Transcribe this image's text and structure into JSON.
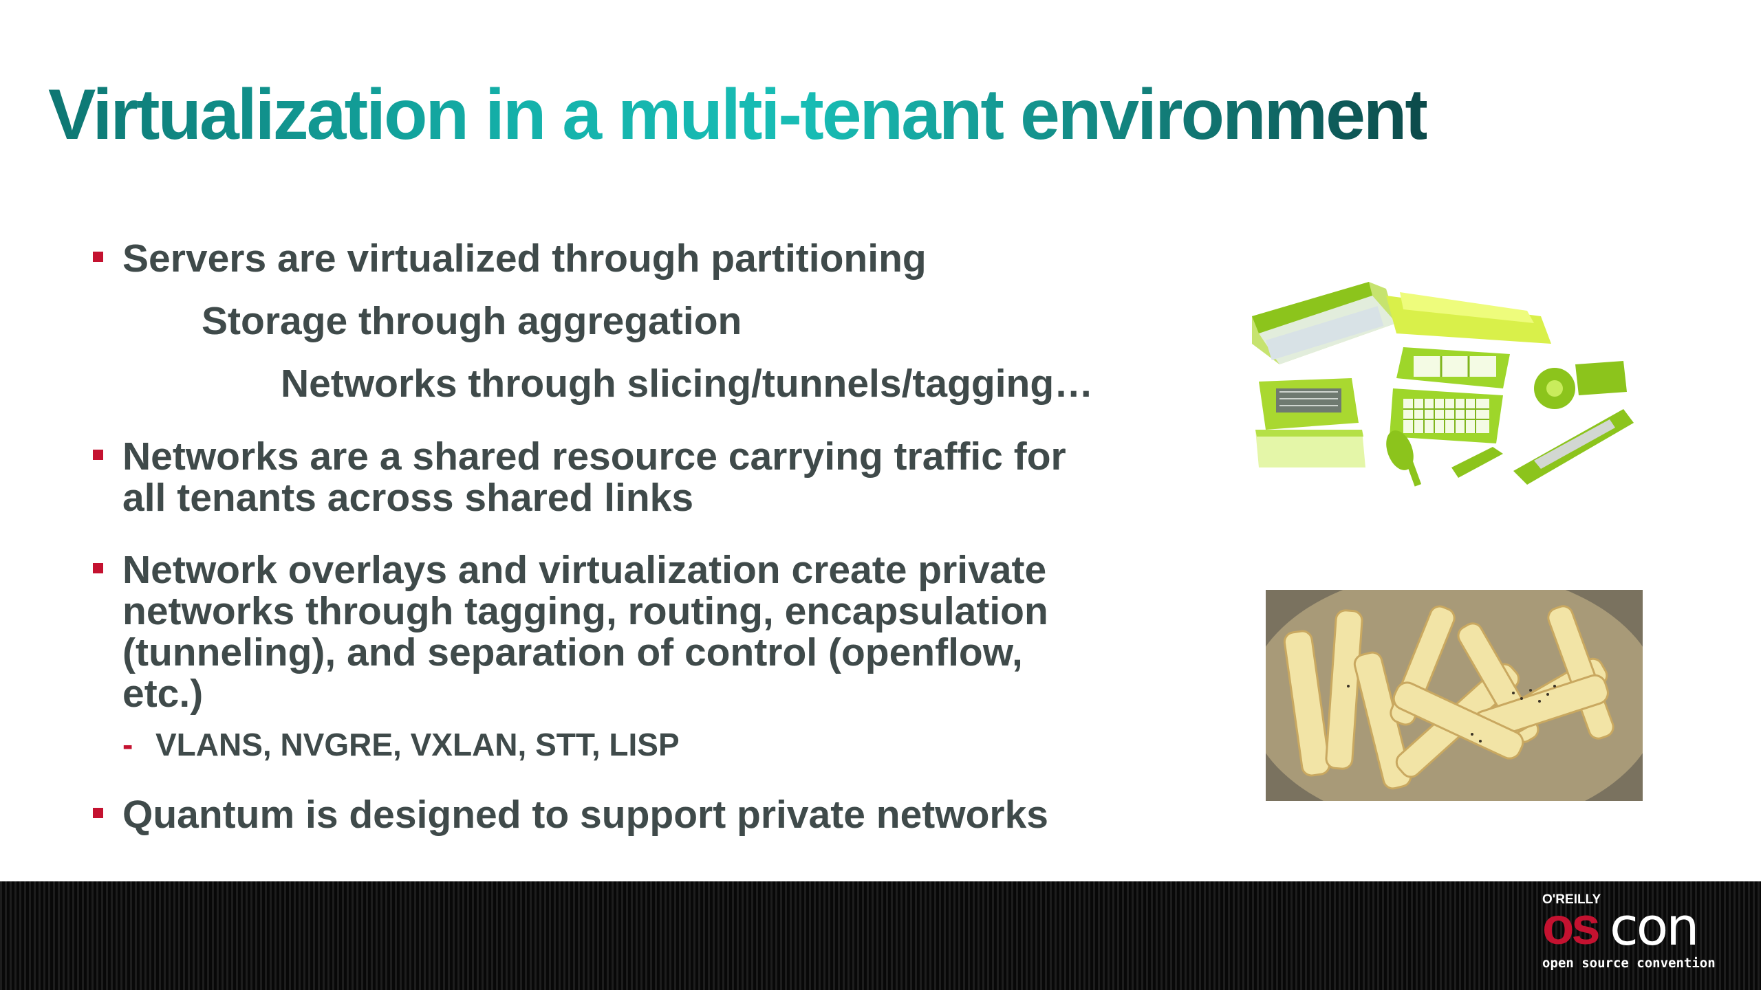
{
  "slide": {
    "title": "Virtualization in a multi-tenant environment",
    "bullets": [
      {
        "lines": [
          "Servers are virtualized through partitioning",
          "Storage through aggregation",
          "Networks through slicing/tunnels/tagging…"
        ]
      },
      {
        "lines": [
          "Networks are a shared resource carrying traffic for",
          "all tenants across shared links"
        ]
      },
      {
        "lines": [
          "Network overlays and virtualization create private",
          "networks through tagging, routing, encapsulation",
          "(tunneling), and separation of control (openflow,",
          "etc.)"
        ],
        "sub_items": [
          "VLANS, NVGRE, VXLAN, STT, LISP"
        ]
      },
      {
        "lines": [
          "Quantum is designed to support private networks"
        ]
      }
    ],
    "images": [
      {
        "name": "vegetable chopper slicer set"
      },
      {
        "name": "bowl of potato fries"
      }
    ]
  },
  "footer": {
    "logo_publisher": "O'REILLY",
    "logo_os": "os",
    "logo_con": "con",
    "logo_tagline": "open source convention"
  },
  "colors": {
    "title_teal": "#18bdb5",
    "body_text": "#3f4a4a",
    "bullet_red": "#c41230",
    "footer_bg": "#0b0b0b",
    "chopper_green": "#9ed62a"
  }
}
